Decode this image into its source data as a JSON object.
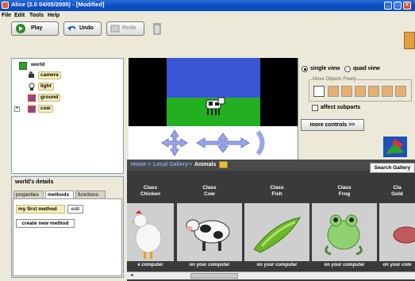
{
  "window": {
    "title": "Alice (2.0 04/05/2005) - [Modified]"
  },
  "menu": [
    "File",
    "Edit",
    "Tools",
    "Help"
  ],
  "toolbar": {
    "play": "Play",
    "undo": "Undo",
    "redo": "Redo"
  },
  "tree": {
    "root": "world",
    "items": [
      "camera",
      "light",
      "ground",
      "cow"
    ]
  },
  "details": {
    "title": "world's details",
    "tabs": [
      "properties",
      "methods",
      "functions"
    ],
    "method": "my first method",
    "edit": "edit",
    "create": "create new method"
  },
  "view": {
    "single": "single view",
    "quad": "quad view",
    "move_label": "Move Objects Freely",
    "affect": "affect subparts",
    "more": "more controls >>"
  },
  "gallery": {
    "breadcrumb": [
      "Home",
      "Local Gallery",
      "Animals"
    ],
    "search": "Search Gallery",
    "cards": [
      {
        "line1": "Class",
        "line2": "Chicken",
        "foot": "e computer"
      },
      {
        "line1": "Class",
        "line2": "Cow",
        "foot": "on your computer"
      },
      {
        "line1": "Class",
        "line2": "Fish",
        "foot": "on your computer"
      },
      {
        "line1": "Class",
        "line2": "Frog",
        "foot": "on your computer"
      },
      {
        "line1": "Cla",
        "line2": "Gold",
        "foot": "on your com"
      }
    ]
  },
  "colors": {
    "titlebar": "#0a4bc4",
    "sky": "#3a55d6",
    "grass": "#22b020",
    "gallery": "#3a3a3a"
  }
}
